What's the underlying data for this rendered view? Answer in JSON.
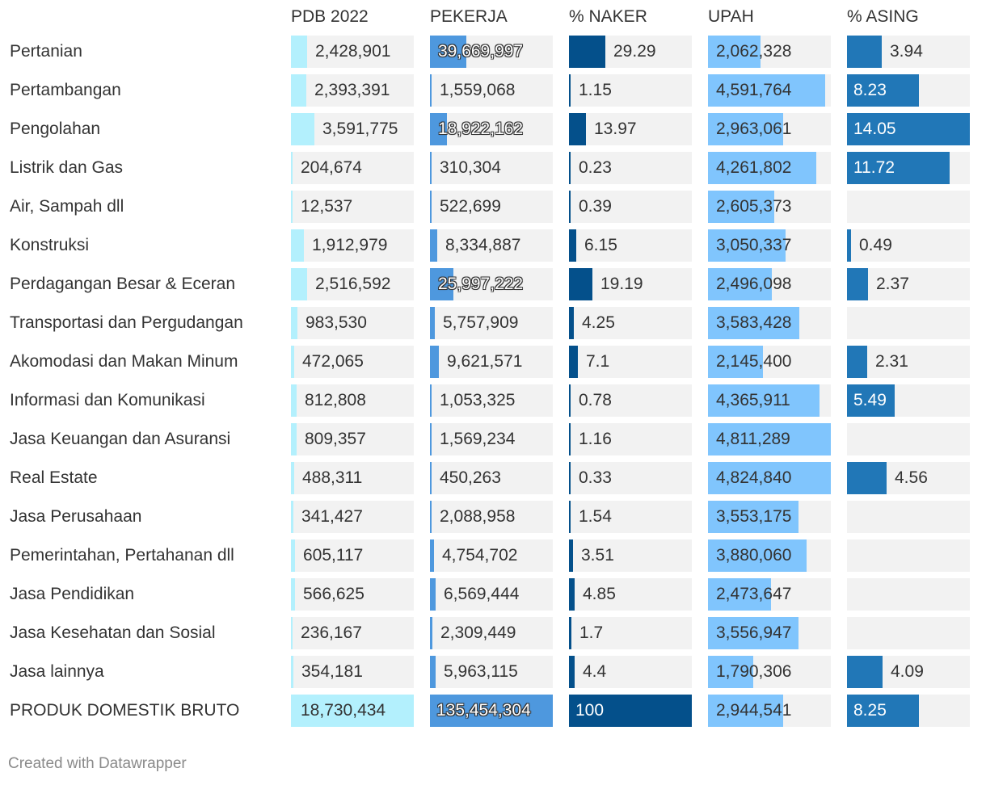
{
  "chart_data": {
    "type": "table",
    "credit": "Created with Datawrapper",
    "columns": [
      {
        "key": "pdb",
        "label": "PDB 2022",
        "color": "#b3f0fd",
        "max": 18730434
      },
      {
        "key": "pekerja",
        "label": "PEKERJA",
        "color": "#4e98de",
        "max": 135454304
      },
      {
        "key": "naker",
        "label": "% NAKER",
        "color": "#04508b",
        "max": 100
      },
      {
        "key": "upah",
        "label": "UPAH",
        "color": "#80c5fd",
        "max": 4824840
      },
      {
        "key": "asing",
        "label": "% ASING",
        "color": "#2177b7",
        "max": 14.05
      }
    ],
    "rows": [
      {
        "sector": "Pertanian",
        "pdb": "2,428,901",
        "pekerja": "39,669,997",
        "naker": "29.29",
        "upah": "2,062,328",
        "asing": "3.94"
      },
      {
        "sector": "Pertambangan",
        "pdb": "2,393,391",
        "pekerja": "1,559,068",
        "naker": "1.15",
        "upah": "4,591,764",
        "asing": "8.23"
      },
      {
        "sector": "Pengolahan",
        "pdb": "3,591,775",
        "pekerja": "18,922,162",
        "naker": "13.97",
        "upah": "2,963,061",
        "asing": "14.05"
      },
      {
        "sector": "Listrik dan Gas",
        "pdb": "204,674",
        "pekerja": "310,304",
        "naker": "0.23",
        "upah": "4,261,802",
        "asing": "11.72"
      },
      {
        "sector": "Air, Sampah dll",
        "pdb": "12,537",
        "pekerja": "522,699",
        "naker": "0.39",
        "upah": "2,605,373",
        "asing": ""
      },
      {
        "sector": "Konstruksi",
        "pdb": "1,912,979",
        "pekerja": "8,334,887",
        "naker": "6.15",
        "upah": "3,050,337",
        "asing": "0.49"
      },
      {
        "sector": "Perdagangan Besar & Eceran",
        "pdb": "2,516,592",
        "pekerja": "25,997,222",
        "naker": "19.19",
        "upah": "2,496,098",
        "asing": "2.37"
      },
      {
        "sector": "Transportasi dan Pergudangan",
        "pdb": "983,530",
        "pekerja": "5,757,909",
        "naker": "4.25",
        "upah": "3,583,428",
        "asing": ""
      },
      {
        "sector": "Akomodasi dan Makan Minum",
        "pdb": "472,065",
        "pekerja": "9,621,571",
        "naker": "7.1",
        "upah": "2,145,400",
        "asing": "2.31"
      },
      {
        "sector": "Informasi dan Komunikasi",
        "pdb": "812,808",
        "pekerja": "1,053,325",
        "naker": "0.78",
        "upah": "4,365,911",
        "asing": "5.49"
      },
      {
        "sector": "Jasa Keuangan dan Asuransi",
        "pdb": "809,357",
        "pekerja": "1,569,234",
        "naker": "1.16",
        "upah": "4,811,289",
        "asing": ""
      },
      {
        "sector": "Real Estate",
        "pdb": "488,311",
        "pekerja": "450,263",
        "naker": "0.33",
        "upah": "4,824,840",
        "asing": "4.56"
      },
      {
        "sector": "Jasa Perusahaan",
        "pdb": "341,427",
        "pekerja": "2,088,958",
        "naker": "1.54",
        "upah": "3,553,175",
        "asing": ""
      },
      {
        "sector": "Pemerintahan, Pertahanan dll",
        "pdb": "605,117",
        "pekerja": "4,754,702",
        "naker": "3.51",
        "upah": "3,880,060",
        "asing": ""
      },
      {
        "sector": "Jasa Pendidikan",
        "pdb": "566,625",
        "pekerja": "6,569,444",
        "naker": "4.85",
        "upah": "2,473,647",
        "asing": ""
      },
      {
        "sector": "Jasa Kesehatan dan Sosial",
        "pdb": "236,167",
        "pekerja": "2,309,449",
        "naker": "1.7",
        "upah": "3,556,947",
        "asing": ""
      },
      {
        "sector": "Jasa lainnya",
        "pdb": "354,181",
        "pekerja": "5,963,115",
        "naker": "4.4",
        "upah": "1,790,306",
        "asing": "4.09"
      },
      {
        "sector": "PRODUK DOMESTIK BRUTO",
        "pdb": "18,730,434",
        "pekerja": "135,454,304",
        "naker": "100",
        "upah": "2,944,541",
        "asing": "8.25"
      }
    ]
  }
}
